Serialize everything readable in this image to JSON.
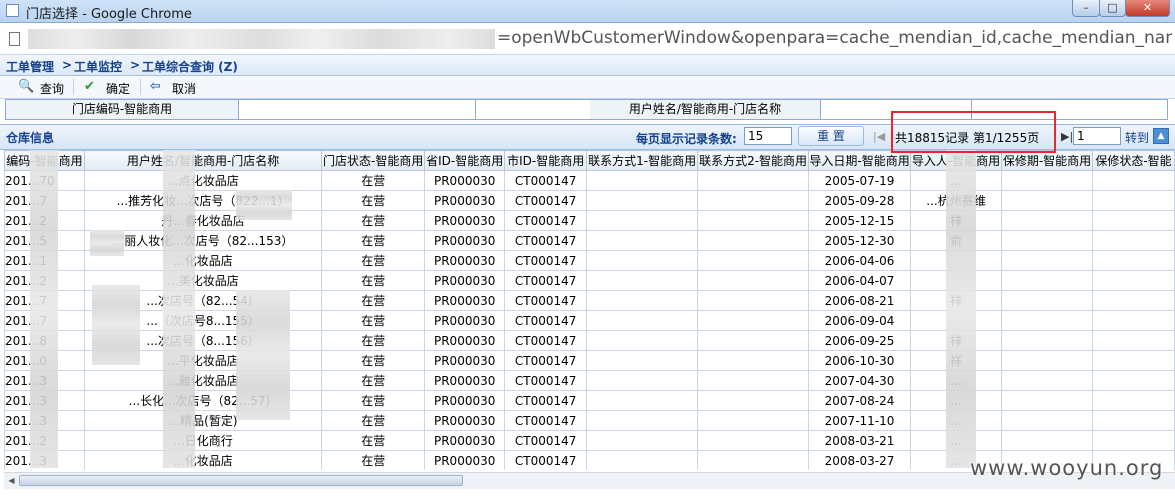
{
  "window": {
    "title": "门店选择 - Google Chrome",
    "minimize": "–",
    "maximize": "□",
    "close": "✕"
  },
  "address": {
    "url_visible": "=openWbCustomerWindow&openpara=cache_mendian_id,cache_mendian_name&popp"
  },
  "breadcrumb": [
    "工单管理",
    "工单监控",
    "工单综合查询 (Z)"
  ],
  "breadcrumb_sep": ">",
  "toolbar": {
    "query": "查询",
    "confirm": "确定",
    "cancel": "取消"
  },
  "search": {
    "store_code_label": "门店编码-智能商用",
    "user_name_label": "用户姓名/智能商用-门店名称",
    "store_code_value": "",
    "user_name_value": ""
  },
  "panel": {
    "title": "仓库信息",
    "page_size_label": "每页显示记录条数:",
    "page_size": "15",
    "reset": "重 置",
    "total": "共18815记录 第1/1255页",
    "page_input": "1",
    "goto": "转到"
  },
  "table": {
    "headers": [
      "编码-智能商用",
      "用户姓名/智能商用-门店名称",
      "门店状态-智能商用",
      "省ID-智能商用",
      "市ID-智能商用",
      "联系方式1-智能商用",
      "联系方式2-智能商用",
      "导入日期-智能商用",
      "导入人-智能商用",
      "保修期-智能商用",
      "保修状态-智能"
    ],
    "rows": [
      [
        "201...70",
        "...点化妆品店",
        "在营",
        "PR000030",
        "CT000147",
        "",
        "",
        "2005-07-19",
        "...",
        "",
        ""
      ],
      [
        "201...7",
        "...推芳化妆...次店号（822...1）",
        "在营",
        "PR000030",
        "CT000147",
        "",
        "",
        "2005-09-28",
        "...杭州赛维",
        "",
        ""
      ],
      [
        "201...2",
        "丹...春化妆品店",
        "在营",
        "PR000030",
        "CT000147",
        "",
        "",
        "2005-12-15",
        "祥",
        "",
        ""
      ],
      [
        "201...5",
        "...丽人妆化...次店号（82...153）",
        "在营",
        "PR000030",
        "CT000147",
        "",
        "",
        "2005-12-30",
        "俞",
        "",
        ""
      ],
      [
        "201...1",
        "...化妆品店",
        "在营",
        "PR000030",
        "CT000147",
        "",
        "",
        "2006-04-06",
        "",
        "",
        ""
      ],
      [
        "201...2",
        "...美化妆品店",
        "在营",
        "PR000030",
        "CT000147",
        "",
        "",
        "2006-04-07",
        "",
        "",
        ""
      ],
      [
        "201...7",
        "...次店号（82...54）",
        "在营",
        "PR000030",
        "CT000147",
        "",
        "",
        "2006-08-21",
        "祥",
        "",
        ""
      ],
      [
        "201...7",
        "...（次店号8...155）",
        "在营",
        "PR000030",
        "CT000147",
        "",
        "",
        "2006-09-04",
        "",
        "",
        ""
      ],
      [
        "201...8",
        "...次店号（8...156）",
        "在营",
        "PR000030",
        "CT000147",
        "",
        "",
        "2006-09-25",
        "祥",
        "",
        ""
      ],
      [
        "201...0",
        "...平化妆品店",
        "在营",
        "PR000030",
        "CT000147",
        "",
        "",
        "2006-10-30",
        "祥",
        "",
        ""
      ],
      [
        "201...3",
        "...雅化妆品店",
        "在营",
        "PR000030",
        "CT000147",
        "",
        "",
        "2007-04-30",
        "...",
        "",
        ""
      ],
      [
        "201...3",
        "...长化...次店号（82...57）",
        "在营",
        "PR000030",
        "CT000147",
        "",
        "",
        "2007-08-24",
        "...",
        "",
        ""
      ],
      [
        "201...3",
        "...精品(暂定)",
        "在营",
        "PR000030",
        "CT000147",
        "",
        "",
        "2007-11-10",
        "...",
        "",
        ""
      ],
      [
        "201...2",
        "...日化商行",
        "在营",
        "PR000030",
        "CT000147",
        "",
        "",
        "2008-03-21",
        "...",
        "",
        ""
      ],
      [
        "201...3",
        "...化妆品店",
        "在营",
        "PR000030",
        "CT000147",
        "",
        "",
        "2008-03-27",
        "...",
        "",
        ""
      ]
    ]
  },
  "watermark": "www.wooyun.org",
  "colors": {
    "accent": "#15428b",
    "highlight": "#e8282c"
  }
}
